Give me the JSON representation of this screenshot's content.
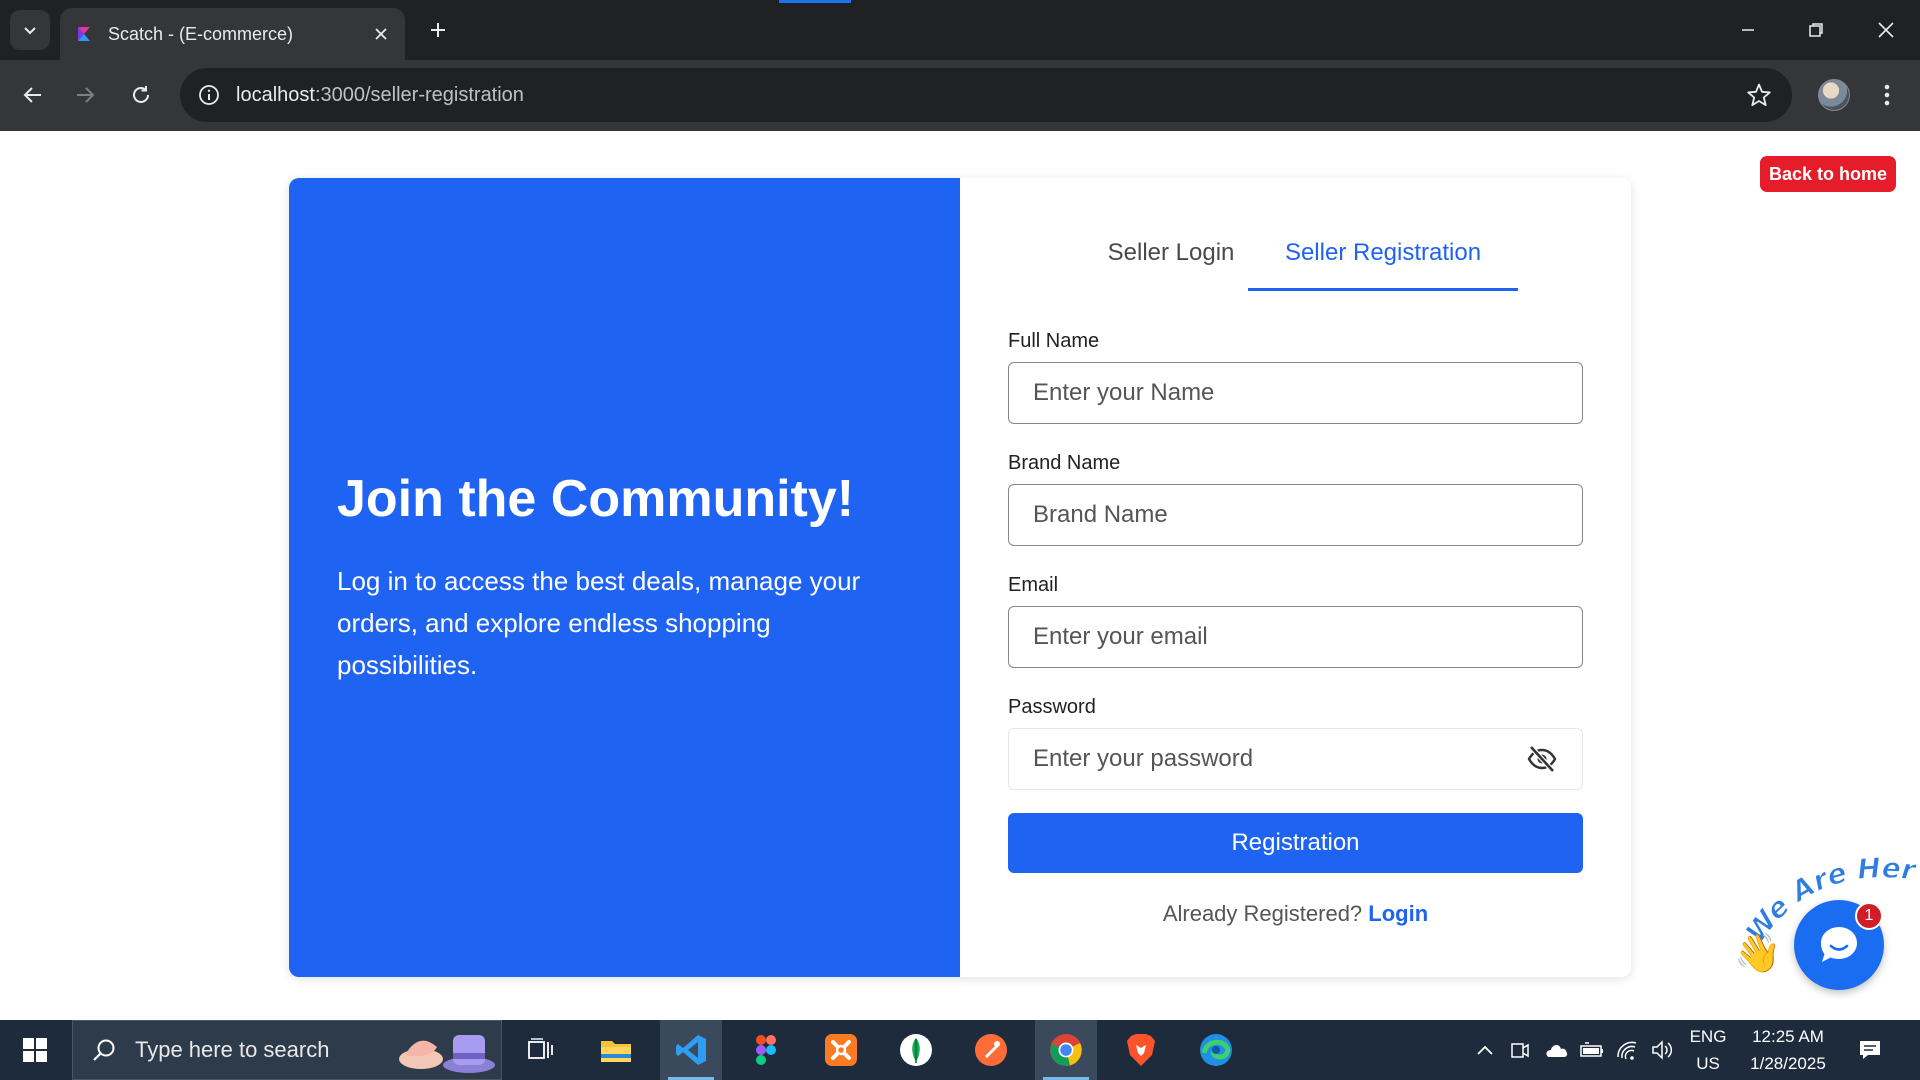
{
  "browser": {
    "tab_title": "Scatch - (E-commerce)",
    "url_host": "localhost",
    "url_path": ":3000/seller-registration"
  },
  "page": {
    "back_home": "Back to home",
    "hero_title": "Join the Community!",
    "hero_text": "Log in to access the best deals, manage your orders, and explore endless shopping possibilities.",
    "tabs": [
      {
        "label": "Seller Login",
        "active": false
      },
      {
        "label": "Seller Registration",
        "active": true
      }
    ],
    "form": {
      "full_name": {
        "label": "Full Name",
        "placeholder": "Enter your Name"
      },
      "brand_name": {
        "label": "Brand Name",
        "placeholder": "Brand Name"
      },
      "email": {
        "label": "Email",
        "placeholder": "Enter your email"
      },
      "password": {
        "label": "Password",
        "placeholder": "Enter your password"
      },
      "submit": "Registration"
    },
    "already_text": "Already Registered?",
    "login_link": "Login",
    "chat": {
      "tagline": "We Are Here!",
      "unread": "1"
    }
  },
  "taskbar": {
    "search_placeholder": "Type here to search",
    "lang_top": "ENG",
    "lang_bottom": "US",
    "time": "12:25 AM",
    "date": "1/28/2025"
  },
  "colors": {
    "brand_blue": "#1f63f2",
    "back_home_red": "#e51d2a",
    "chrome_dark": "#202124",
    "taskbar": "#1d2b3c"
  }
}
